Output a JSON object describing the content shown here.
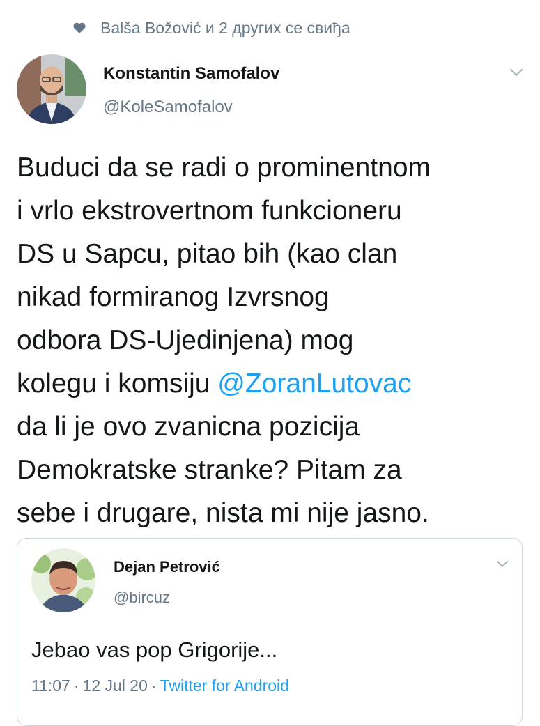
{
  "social_context": {
    "icon": "heart-icon",
    "text": "Balša Božović и 2 других се свиђа"
  },
  "main_tweet": {
    "author": {
      "name": "Konstantin Samofalov",
      "handle": "@KoleSamofalov",
      "avatar_icon": "avatar"
    },
    "text_before_mention": "Buduci da se radi o prominentnom\ni vrlo ekstrovertnom funkcioneru\nDS u Sapcu, pitao bih (kao clan\nnikad formiranog Izvrsnog\nodbora DS-Ujedinjena) mog\nkolegu i komsiju ",
    "mention": "@ZoranLutovac",
    "text_after_mention": "\nda li je ovo zvanicna pozicija\nDemokratske stranke? Pitam za\nsebe i drugare, nista mi nije jasno."
  },
  "quoted_tweet": {
    "author": {
      "name": "Dejan Petrović",
      "handle": "@bircuz",
      "avatar_icon": "avatar"
    },
    "text": "Jebao vas pop Grigorije...",
    "time": "11:07",
    "date": "12 Jul 20",
    "separator": "·",
    "source": "Twitter for Android"
  },
  "colors": {
    "link": "#1da1f2",
    "secondary_text": "#657786",
    "primary_text": "#14171a",
    "border": "#ccd6dd"
  }
}
